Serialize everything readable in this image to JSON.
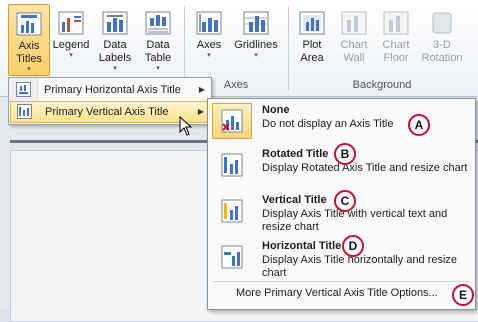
{
  "ribbon": {
    "buttons": [
      {
        "line1": "Axis",
        "line2": "Titles",
        "arrow": "▾",
        "icon": "axis-titles-icon"
      },
      {
        "line1": "Legend",
        "line2": "",
        "arrow": "▾",
        "icon": "legend-icon"
      },
      {
        "line1": "Data",
        "line2": "Labels",
        "arrow": "▾",
        "icon": "data-labels-icon"
      },
      {
        "line1": "Data",
        "line2": "Table",
        "arrow": "▾",
        "icon": "data-table-icon"
      },
      {
        "line1": "Axes",
        "line2": "",
        "arrow": "▾",
        "icon": "axes-icon"
      },
      {
        "line1": "Gridlines",
        "line2": "",
        "arrow": "▾",
        "icon": "gridlines-icon"
      },
      {
        "line1": "Plot",
        "line2": "Area",
        "arrow": "▾",
        "icon": "plot-area-icon"
      },
      {
        "line1": "Chart",
        "line2": "Wall",
        "arrow": "▾",
        "icon": "chart-wall-icon"
      },
      {
        "line1": "Chart",
        "line2": "Floor",
        "arrow": "▾",
        "icon": "chart-floor-icon"
      },
      {
        "line1": "3-D",
        "line2": "Rotation",
        "arrow": "",
        "icon": "3d-rotation-icon"
      }
    ],
    "groups": {
      "axes": "Axes",
      "background": "Background"
    }
  },
  "submenu": {
    "items": [
      {
        "label": "Primary Horizontal Axis Title",
        "hotkey_label": "Primary Horizontal Axis Title",
        "chevron": "▶"
      },
      {
        "label": "Primary Vertical Axis Title",
        "chevron": "▶"
      }
    ]
  },
  "dropdown": {
    "options": [
      {
        "title": "None",
        "desc": "Do not display an Axis Title",
        "badge": "A"
      },
      {
        "title": "Rotated Title",
        "desc": "Display Rotated Axis Title and resize chart",
        "badge": "B"
      },
      {
        "title": "Vertical Title",
        "desc": "Display Axis Title with vertical text and resize chart",
        "badge": "C"
      },
      {
        "title": "Horizontal Title",
        "desc": "Display Axis Title horizontally and resize chart",
        "badge": "D"
      }
    ],
    "more": "More Primary Vertical Axis Title Options...",
    "more_badge": "E"
  },
  "colors": {
    "accent": "#fbd777",
    "badge_ring": "#c8102e",
    "title_bar": "#4472c4"
  }
}
